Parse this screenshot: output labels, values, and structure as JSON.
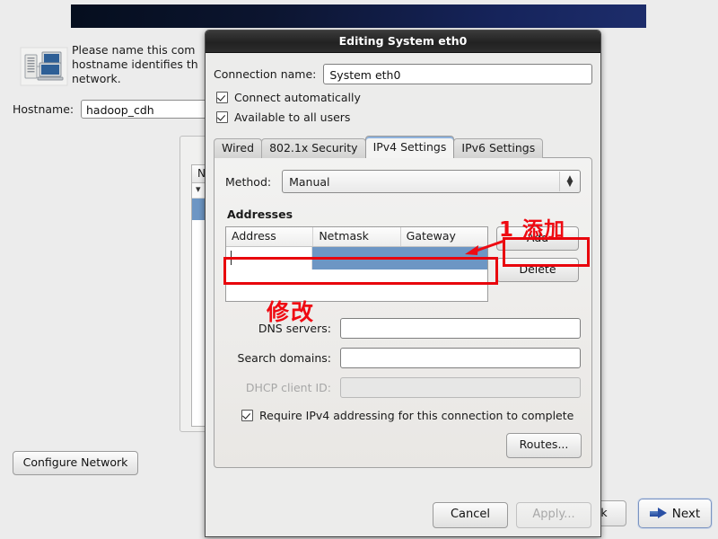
{
  "background": {
    "intro_text": "Please name this com hostname identifies th network.",
    "hostname_label": "Hostname:",
    "hostname_value": "hadoop_cdh",
    "list_header": "N",
    "configure_network_label": "Configure Network",
    "back_label": "k",
    "next_label": "Next",
    "next_icon": "arrow-right-icon",
    "computer_icon": "computer-network-icon",
    "banner_color": "#16245c"
  },
  "dialog": {
    "title": "Editing System eth0",
    "connection_name_label": "Connection name:",
    "connection_name_value": "System eth0",
    "checkboxes": [
      {
        "label": "Connect automatically",
        "checked": true
      },
      {
        "label": "Available to all users",
        "checked": true
      }
    ],
    "tabs": [
      {
        "label": "Wired",
        "active": false
      },
      {
        "label": "802.1x Security",
        "active": false
      },
      {
        "label": "IPv4 Settings",
        "active": true
      },
      {
        "label": "IPv6 Settings",
        "active": false
      }
    ],
    "method_label": "Method:",
    "method_value": "Manual",
    "method_spinner_icon": "spinner-up-down-icon",
    "addresses_title": "Addresses",
    "address_columns": [
      "Address",
      "Netmask",
      "Gateway"
    ],
    "address_rows": [
      {
        "address": "",
        "netmask": "",
        "gateway": "",
        "selected": true
      }
    ],
    "add_label": "Add",
    "delete_label": "Delete",
    "dns_label": "DNS servers:",
    "dns_value": "",
    "search_domains_label": "Search domains:",
    "search_domains_value": "",
    "dhcp_label": "DHCP client ID:",
    "dhcp_value": "",
    "dhcp_disabled": true,
    "require_ipv4_label": "Require IPv4 addressing for this connection to complete",
    "require_ipv4_checked": true,
    "routes_label": "Routes...",
    "cancel_label": "Cancel",
    "apply_label": "Apply...",
    "apply_disabled": true,
    "selection_color": "#6d96c4"
  },
  "annotations": {
    "add_note": "1 添加",
    "modify_note": "修改",
    "color": "#ef0a12"
  }
}
